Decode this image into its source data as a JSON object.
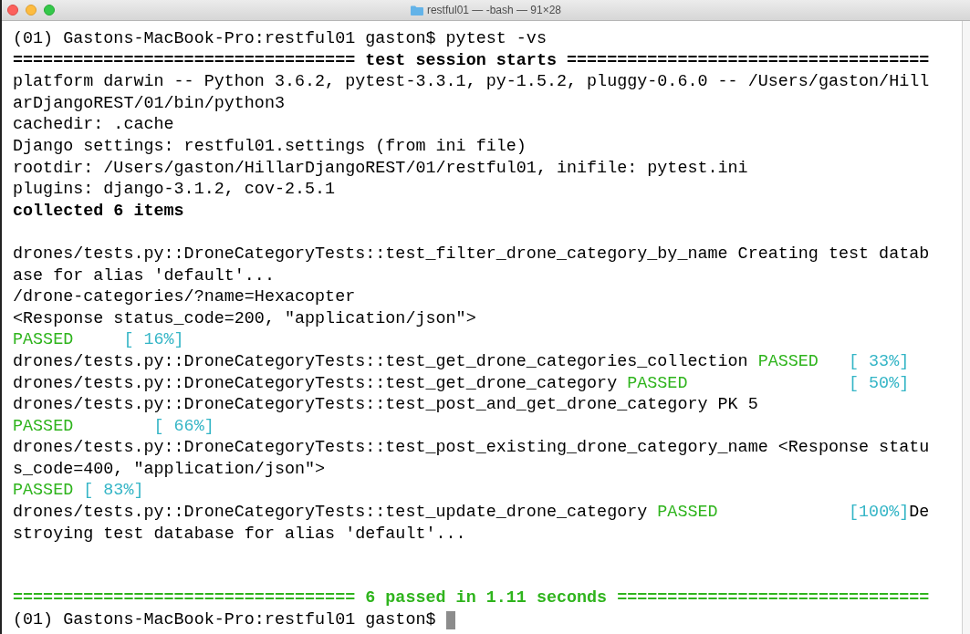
{
  "window": {
    "title": "restful01 — -bash — 91×28"
  },
  "terminal": {
    "lines": [
      {
        "kind": "text",
        "segments": [
          {
            "kind": "plain",
            "text": "(01) Gastons-MacBook-Pro:restful01 gaston$ pytest -vs"
          }
        ]
      },
      {
        "kind": "text",
        "segments": [
          {
            "kind": "bold",
            "text": "================================== test session starts ===================================="
          }
        ]
      },
      {
        "kind": "text",
        "segments": [
          {
            "kind": "plain",
            "text": "platform darwin -- Python 3.6.2, pytest-3.3.1, py-1.5.2, pluggy-0.6.0 -- /Users/gaston/Hill"
          }
        ]
      },
      {
        "kind": "text",
        "segments": [
          {
            "kind": "plain",
            "text": "arDjangoREST/01/bin/python3"
          }
        ]
      },
      {
        "kind": "text",
        "segments": [
          {
            "kind": "plain",
            "text": "cachedir: .cache"
          }
        ]
      },
      {
        "kind": "text",
        "segments": [
          {
            "kind": "plain",
            "text": "Django settings: restful01.settings (from ini file)"
          }
        ]
      },
      {
        "kind": "text",
        "segments": [
          {
            "kind": "plain",
            "text": "rootdir: /Users/gaston/HillarDjangoREST/01/restful01, inifile: pytest.ini"
          }
        ]
      },
      {
        "kind": "text",
        "segments": [
          {
            "kind": "plain",
            "text": "plugins: django-3.1.2, cov-2.5.1"
          }
        ]
      },
      {
        "kind": "text",
        "segments": [
          {
            "kind": "bold",
            "text": "collected 6 items"
          }
        ]
      },
      {
        "kind": "blank"
      },
      {
        "kind": "text",
        "segments": [
          {
            "kind": "plain",
            "text": "drones/tests.py::DroneCategoryTests::test_filter_drone_category_by_name Creating test datab"
          }
        ]
      },
      {
        "kind": "text",
        "segments": [
          {
            "kind": "plain",
            "text": "ase for alias 'default'..."
          }
        ]
      },
      {
        "kind": "text",
        "segments": [
          {
            "kind": "plain",
            "text": "/drone-categories/?name=Hexacopter"
          }
        ]
      },
      {
        "kind": "text",
        "segments": [
          {
            "kind": "plain",
            "text": "<Response status_code=200, \"application/json\">"
          }
        ]
      },
      {
        "kind": "text",
        "segments": [
          {
            "kind": "green",
            "text": "PASSED"
          },
          {
            "kind": "cyan",
            "text": "     [ 16%]"
          }
        ]
      },
      {
        "kind": "text",
        "segments": [
          {
            "kind": "plain",
            "text": "drones/tests.py::DroneCategoryTests::test_get_drone_categories_collection "
          },
          {
            "kind": "green",
            "text": "PASSED"
          },
          {
            "kind": "cyan",
            "text": "   [ 33%]"
          }
        ]
      },
      {
        "kind": "text",
        "segments": [
          {
            "kind": "plain",
            "text": "drones/tests.py::DroneCategoryTests::test_get_drone_category "
          },
          {
            "kind": "green",
            "text": "PASSED"
          },
          {
            "kind": "cyan",
            "text": "                [ 50%]"
          }
        ]
      },
      {
        "kind": "text",
        "segments": [
          {
            "kind": "plain",
            "text": "drones/tests.py::DroneCategoryTests::test_post_and_get_drone_category PK 5"
          }
        ]
      },
      {
        "kind": "text",
        "segments": [
          {
            "kind": "green",
            "text": "PASSED"
          },
          {
            "kind": "cyan",
            "text": "        [ 66%]"
          }
        ]
      },
      {
        "kind": "text",
        "segments": [
          {
            "kind": "plain",
            "text": "drones/tests.py::DroneCategoryTests::test_post_existing_drone_category_name <Response statu"
          }
        ]
      },
      {
        "kind": "text",
        "segments": [
          {
            "kind": "plain",
            "text": "s_code=400, \"application/json\">"
          }
        ]
      },
      {
        "kind": "text",
        "segments": [
          {
            "kind": "green",
            "text": "PASSED"
          },
          {
            "kind": "cyan",
            "text": " [ 83%]"
          }
        ]
      },
      {
        "kind": "text",
        "segments": [
          {
            "kind": "plain",
            "text": "drones/tests.py::DroneCategoryTests::test_update_drone_category "
          },
          {
            "kind": "green",
            "text": "PASSED"
          },
          {
            "kind": "cyan",
            "text": "             [100%]"
          },
          {
            "kind": "plain",
            "text": "De"
          }
        ]
      },
      {
        "kind": "text",
        "segments": [
          {
            "kind": "plain",
            "text": "stroying test database for alias 'default'..."
          }
        ]
      },
      {
        "kind": "blank"
      },
      {
        "kind": "blank"
      },
      {
        "kind": "text",
        "segments": [
          {
            "kind": "greenbold",
            "text": "================================== 6 passed in 1.11 seconds ==============================="
          }
        ]
      },
      {
        "kind": "text",
        "cursor": true,
        "segments": [
          {
            "kind": "plain",
            "text": "(01) Gastons-MacBook-Pro:restful01 gaston$ "
          }
        ]
      }
    ]
  }
}
